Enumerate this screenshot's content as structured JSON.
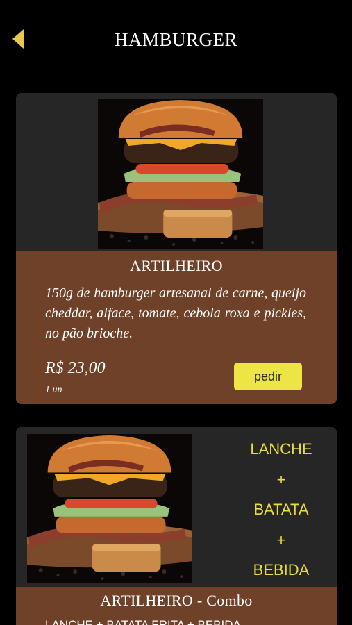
{
  "header": {
    "title": "HAMBURGER",
    "back_icon": "chevron-left-icon",
    "accent_color": "#e8c84a"
  },
  "products": [
    {
      "title": "ARTILHEIRO",
      "image": "burger-photo",
      "description": "150g de hamburger artesanal de carne, queijo cheddar, alface, tomate, cebola roxa e pickles, no pão brioche.",
      "price": "R$ 23,00",
      "unit": "1 un",
      "order_label": "pedir"
    },
    {
      "title": "ARTILHEIRO - Combo",
      "image": "burger-photo",
      "combo_lines": [
        "LANCHE",
        "+",
        "BATATA",
        "+",
        "BEBIDA"
      ],
      "description": "LANCHE + BATATA FRITA + BEBIDA"
    }
  ],
  "colors": {
    "background": "#000000",
    "card_body": "#6e4128",
    "card_top": "#262626",
    "button": "#ede543",
    "combo_text": "#e8dd3c"
  }
}
